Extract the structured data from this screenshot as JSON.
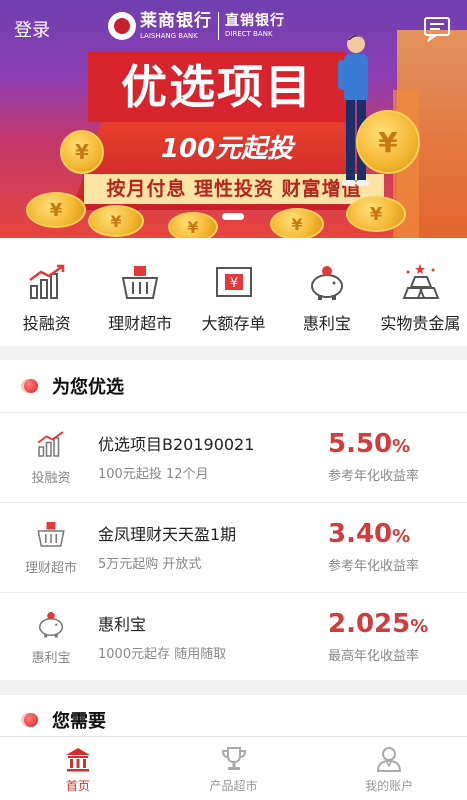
{
  "header": {
    "login_label": "登录",
    "message_icon": "message-icon"
  },
  "banner": {
    "bank_name": "莱商银行",
    "bank_en": "LAISHANG BANK",
    "direct_name": "直销银行",
    "direct_en": "DIRECT BANK",
    "headline": "优选项目",
    "invest_text": "100元起投",
    "slogan": "按月付息  理性投资  财富增值",
    "coin_symbol": "¥"
  },
  "quick_nav": [
    {
      "label": "投融资",
      "icon": "chart-growth-icon"
    },
    {
      "label": "理财超市",
      "icon": "shopping-basket-icon"
    },
    {
      "label": "大额存单",
      "icon": "deposit-certificate-icon"
    },
    {
      "label": "惠利宝",
      "icon": "piggy-bank-icon"
    },
    {
      "label": "实物贵金属",
      "icon": "gold-bars-icon"
    }
  ],
  "recommend": {
    "title": "为您优选",
    "products": [
      {
        "category": "投融资",
        "name": "优选项目B20190021",
        "detail": "100元起投  12个月",
        "rate": "5.50",
        "rate_unit": "%",
        "rate_label": "参考年化收益率",
        "icon": "chart-growth-icon"
      },
      {
        "category": "理财超市",
        "name": "金凤理财天天盈1期",
        "detail": "5万元起购  开放式",
        "rate": "3.40",
        "rate_unit": "%",
        "rate_label": "参考年化收益率",
        "icon": "shopping-basket-icon"
      },
      {
        "category": "惠利宝",
        "name": "惠利宝",
        "detail": "1000元起存  随用随取",
        "rate": "2.025",
        "rate_unit": "%",
        "rate_label": "最高年化收益率",
        "icon": "piggy-bank-icon"
      }
    ]
  },
  "needs": {
    "title": "您需要"
  },
  "tabbar": [
    {
      "label": "首页",
      "icon": "bank-home-icon",
      "active": true
    },
    {
      "label": "产品超市",
      "icon": "trophy-icon",
      "active": false
    },
    {
      "label": "我的账户",
      "icon": "user-account-icon",
      "active": false
    }
  ],
  "colors": {
    "brand_red": "#d0312d",
    "rate_red": "#d23c3c",
    "text_gray": "#888888"
  }
}
